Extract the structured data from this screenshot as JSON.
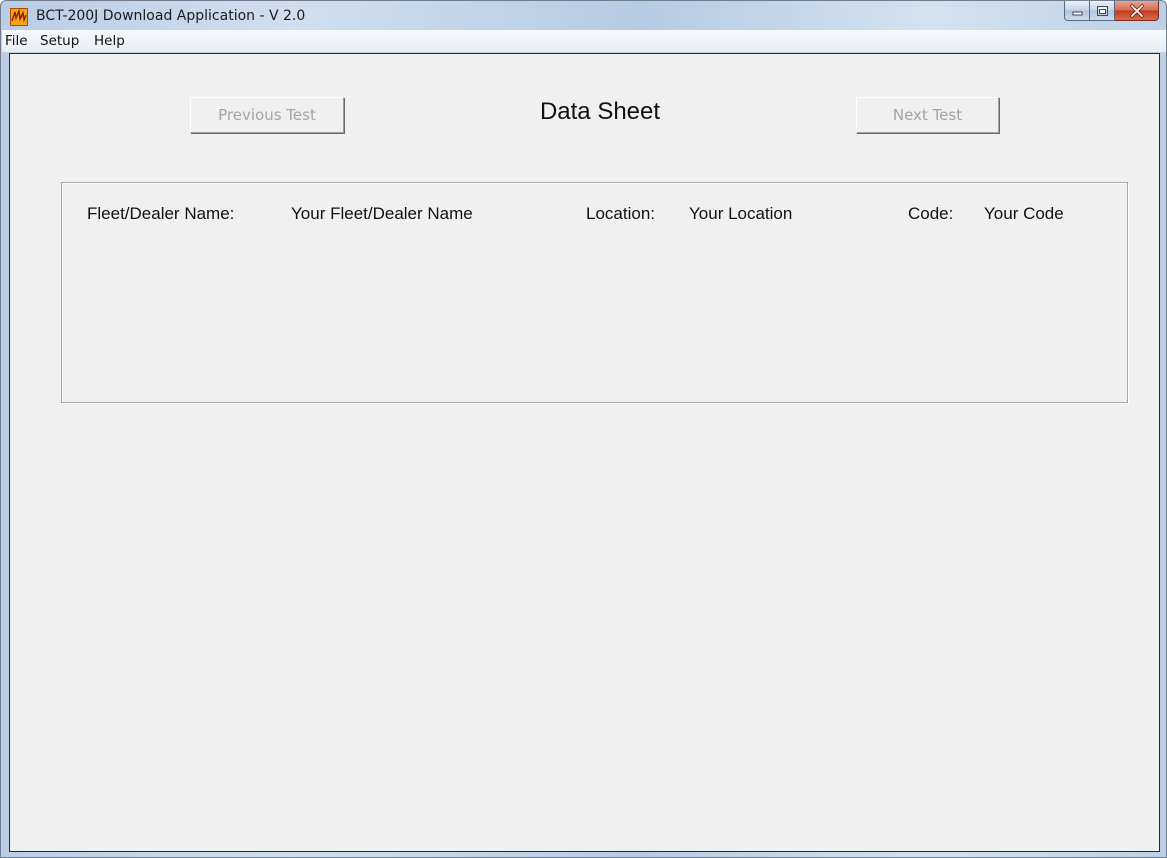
{
  "window": {
    "title": "BCT-200J Download Application - V 2.0",
    "icon": "app-logo-icon"
  },
  "menu": {
    "items": [
      "File",
      "Setup",
      "Help"
    ]
  },
  "toolbar": {
    "previous_label": "Previous Test",
    "next_label": "Next Test",
    "title": "Data Sheet"
  },
  "info": {
    "fleet_label": "Fleet/Dealer Name:",
    "fleet_value": "Your Fleet/Dealer Name",
    "location_label": "Location:",
    "location_value": "Your Location",
    "code_label": "Code:",
    "code_value": "Your Code"
  },
  "colors": {
    "client_bg": "#f0f0f0",
    "disabled_text": "#a4a4a4"
  }
}
